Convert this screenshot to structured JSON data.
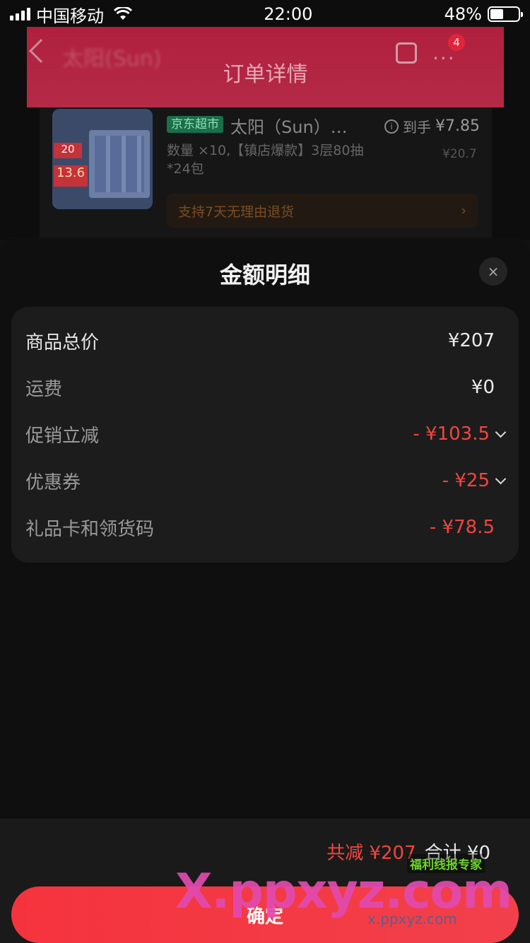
{
  "status_bar": {
    "carrier": "中国移动",
    "time": "22:00",
    "battery": "48%",
    "battery_level": 0.48
  },
  "background_page": {
    "title": "订单详情",
    "title_overlay": "太阳(Sun)",
    "badge": "4",
    "more": "···",
    "product": {
      "store_tag": "京东超市",
      "name": "太阳（Sun）…",
      "to_hand_label": "到手",
      "to_hand_price": "¥7.85",
      "description": "数量 ×10,【镇店爆款】3层80抽*24包",
      "original_price": "¥20.7",
      "thumb_tag_1": "20",
      "thumb_tag_2": "13.6",
      "return_policy": "支持7天无理由退货"
    }
  },
  "sheet": {
    "title": "金额明细",
    "close": "×",
    "rows": [
      {
        "label": "商品总价",
        "value": "¥207"
      },
      {
        "label": "运费",
        "value": "¥0"
      },
      {
        "label": "促销立减",
        "value": "- ¥103.5"
      },
      {
        "label": "优惠券",
        "value": "- ¥25"
      },
      {
        "label": "礼品卡和领货码",
        "value": "- ¥78.5"
      }
    ]
  },
  "footer": {
    "total_saved": "共减 ¥207",
    "total": "合计 ¥0",
    "confirm_label": "确定"
  },
  "watermark": {
    "logo": "X.ppxyz.com",
    "tag": "福利线报专家",
    "url": "x.ppxyz.com"
  }
}
